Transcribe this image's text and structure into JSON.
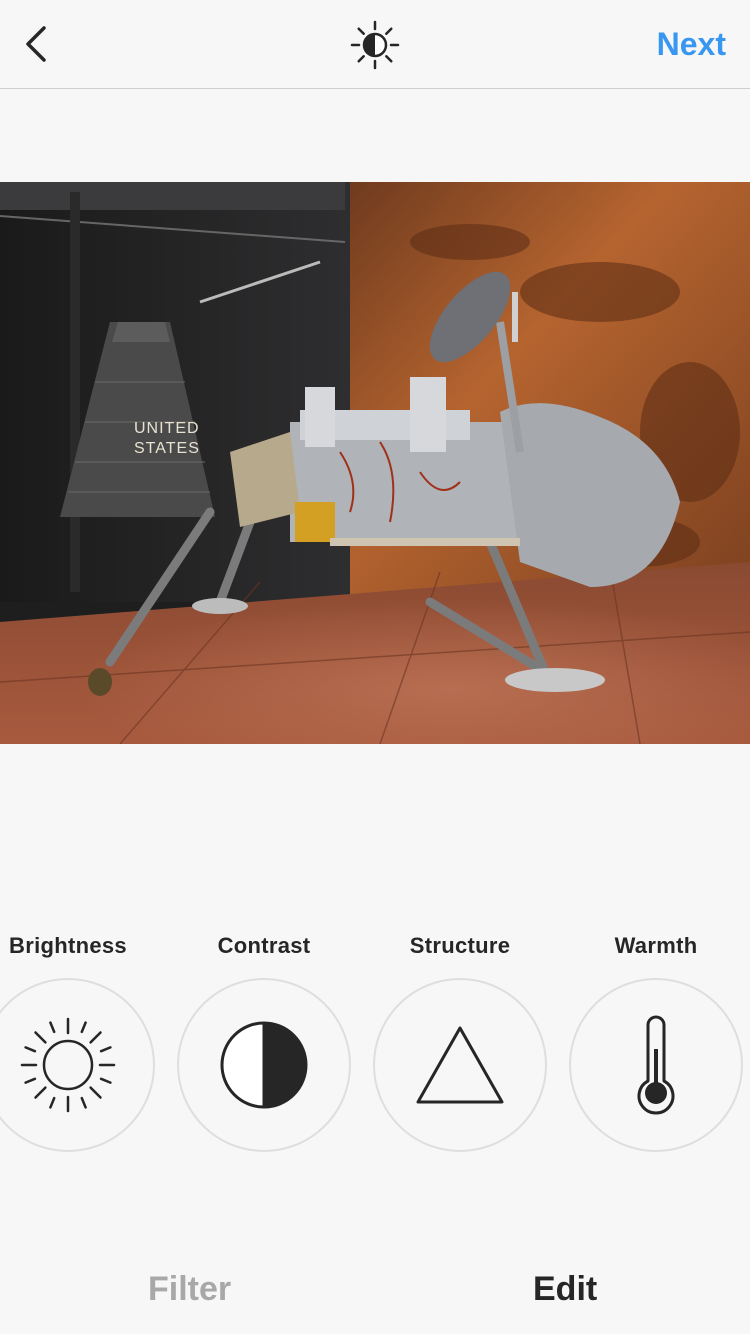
{
  "header": {
    "back_icon": "chevron-left-icon",
    "lux_icon": "lux-sun-half-icon",
    "next_label": "Next",
    "next_color": "#3897f0"
  },
  "photo": {
    "capsule_text_line1": "UNITED",
    "capsule_text_line2": "STATES"
  },
  "tools": [
    {
      "label": "Brightness",
      "icon": "brightness-sun-icon"
    },
    {
      "label": "Contrast",
      "icon": "contrast-half-circle-icon"
    },
    {
      "label": "Structure",
      "icon": "structure-triangle-icon"
    },
    {
      "label": "Warmth",
      "icon": "warmth-thermometer-icon"
    }
  ],
  "tabs": {
    "filter_label": "Filter",
    "edit_label": "Edit",
    "active": "Edit"
  }
}
